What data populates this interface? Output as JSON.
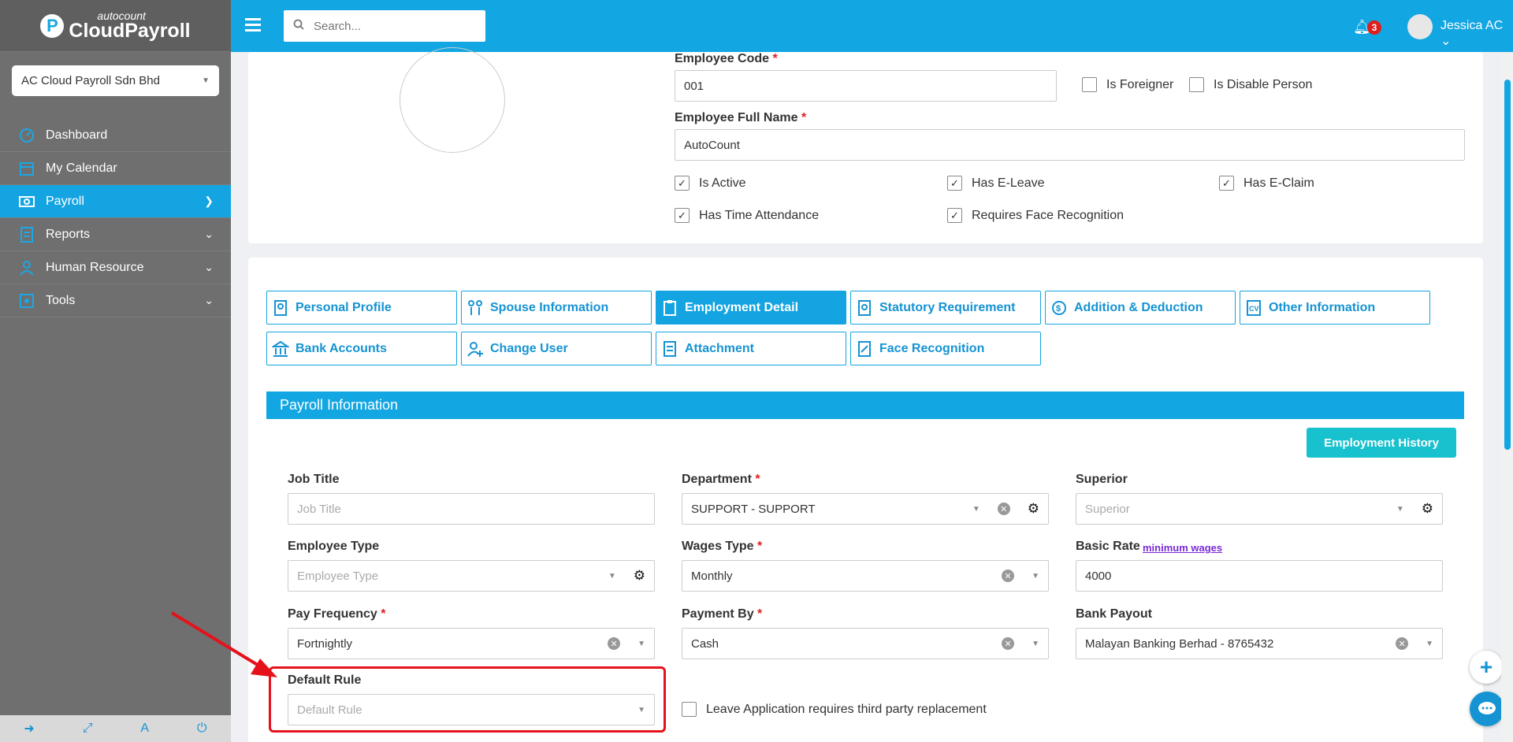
{
  "app": {
    "brand_small": "autocount",
    "brand_big": "CloudPayroll",
    "accent": "#12a6e2"
  },
  "search": {
    "placeholder": "Search..."
  },
  "topbar": {
    "notification_count": "3",
    "user_name": "Jessica AC"
  },
  "company": "AC Cloud Payroll Sdn Bhd",
  "nav": [
    {
      "label": "Dashboard",
      "icon": "dashboard-icon"
    },
    {
      "label": "My Calendar",
      "icon": "calendar-icon"
    },
    {
      "label": "Payroll",
      "icon": "payroll-icon"
    },
    {
      "label": "Reports",
      "icon": "reports-icon"
    },
    {
      "label": "Human Resource",
      "icon": "human-resource-icon"
    },
    {
      "label": "Tools",
      "icon": "tools-icon"
    }
  ],
  "employee": {
    "code_label": "Employee Code",
    "code": "001",
    "name_label": "Employee Full Name",
    "name": "AutoCount",
    "is_foreigner": "Is Foreigner",
    "is_disable_person": "Is Disable Person",
    "is_active": "Is Active",
    "has_eleave": "Has E-Leave",
    "has_eclaim": "Has E-Claim",
    "has_time_attendance": "Has Time Attendance",
    "requires_face": "Requires Face Recognition"
  },
  "tabs": [
    "Personal Profile",
    "Spouse Information",
    "Employment Detail",
    "Statutory Requirement",
    "Addition & Deduction",
    "Other Information",
    "Bank Accounts",
    "Change User",
    "Attachment",
    "Face Recognition"
  ],
  "section": {
    "title": "Payroll Information",
    "history_button": "Employment History"
  },
  "form": {
    "job_title_label": "Job Title",
    "job_title_placeholder": "Job Title",
    "department_label": "Department",
    "department": "SUPPORT - SUPPORT",
    "superior_label": "Superior",
    "superior_placeholder": "Superior",
    "employee_type_label": "Employee Type",
    "employee_type_placeholder": "Employee Type",
    "wages_type_label": "Wages Type",
    "wages_type": "Monthly",
    "basic_rate_label": "Basic Rate",
    "min_wages_link": "minimum wages",
    "basic_rate": "4000",
    "pay_frequency_label": "Pay Frequency",
    "pay_frequency": "Fortnightly",
    "payment_by_label": "Payment By",
    "payment_by": "Cash",
    "bank_payout_label": "Bank Payout",
    "bank_payout": "Malayan Banking Berhad - 8765432",
    "default_rule_label": "Default Rule",
    "default_rule_placeholder": "Default Rule",
    "leave_third_party": "Leave Application requires third party replacement"
  },
  "required_mark": "*",
  "check_mark": "✓",
  "clear_mark": "✕"
}
